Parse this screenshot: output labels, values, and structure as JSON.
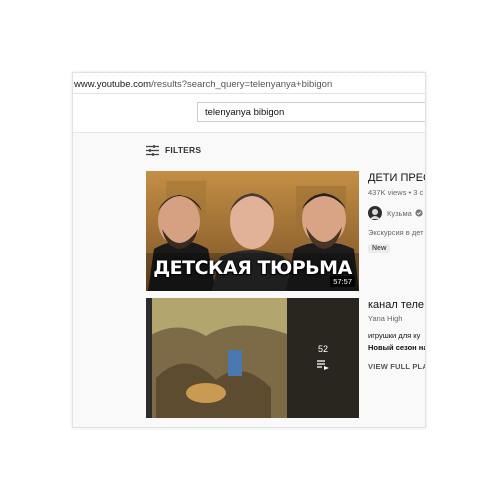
{
  "browser": {
    "url_host": "www.youtube.com",
    "url_path": "/results?search_query=telenyanya+bibigon"
  },
  "search": {
    "query": "telenyanya bibigon"
  },
  "filters": {
    "label": "FILTERS",
    "icon": "filter-sliders-icon"
  },
  "results": [
    {
      "title": "ДЕТИ ПРЕС",
      "views": "437K views",
      "sep": "•",
      "age": "3 с",
      "channel": "Кузьма",
      "verified_icon": "verified-check-icon",
      "description": "Экскурсия в дет",
      "badge": "New",
      "duration": "57:57",
      "thumb_title": "ДЕТСКАЯ ТЮРЬМА"
    },
    {
      "title": "канал теле",
      "channel": "Yana High",
      "line1": "игрушки для ку",
      "line2": "Новый сезон на",
      "count": "52",
      "view_full": "VIEW FULL PLA",
      "playlist_icon": "playlist-icon"
    }
  ],
  "colors": {
    "background": "#f9f9f9",
    "accent": "#cc0000"
  }
}
